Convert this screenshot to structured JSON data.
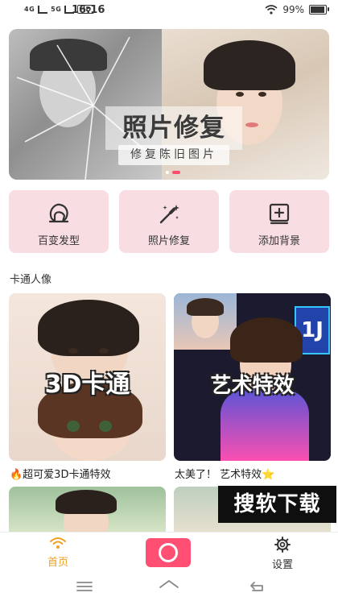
{
  "status_bar": {
    "net1": "4G",
    "net2": "5G",
    "hd": "HD",
    "time": "16:16",
    "battery": "99%",
    "battery_level": 0.99
  },
  "banner": {
    "title": "照片修复",
    "subtitle": "修复陈旧图片"
  },
  "features": [
    {
      "label": "百变发型",
      "icon": "hairstyle-icon"
    },
    {
      "label": "照片修复",
      "icon": "magic-wand-icon"
    },
    {
      "label": "添加背景",
      "icon": "add-box-icon"
    }
  ],
  "section": {
    "title": "卡通人像"
  },
  "cards": [
    {
      "overlay": "3D卡通",
      "caption": "🔥超可爱3D卡通特效"
    },
    {
      "overlay": "艺术特效",
      "caption": "太美了！ 艺术特效⭐",
      "sign_text": "1J"
    }
  ],
  "watermark": "搜软下载",
  "bottom_nav": {
    "home_label": "首页",
    "settings_label": "设置"
  },
  "colors": {
    "accent": "#ff4f72",
    "feature_bg": "#f8dde3",
    "home_active": "#f0a020"
  }
}
